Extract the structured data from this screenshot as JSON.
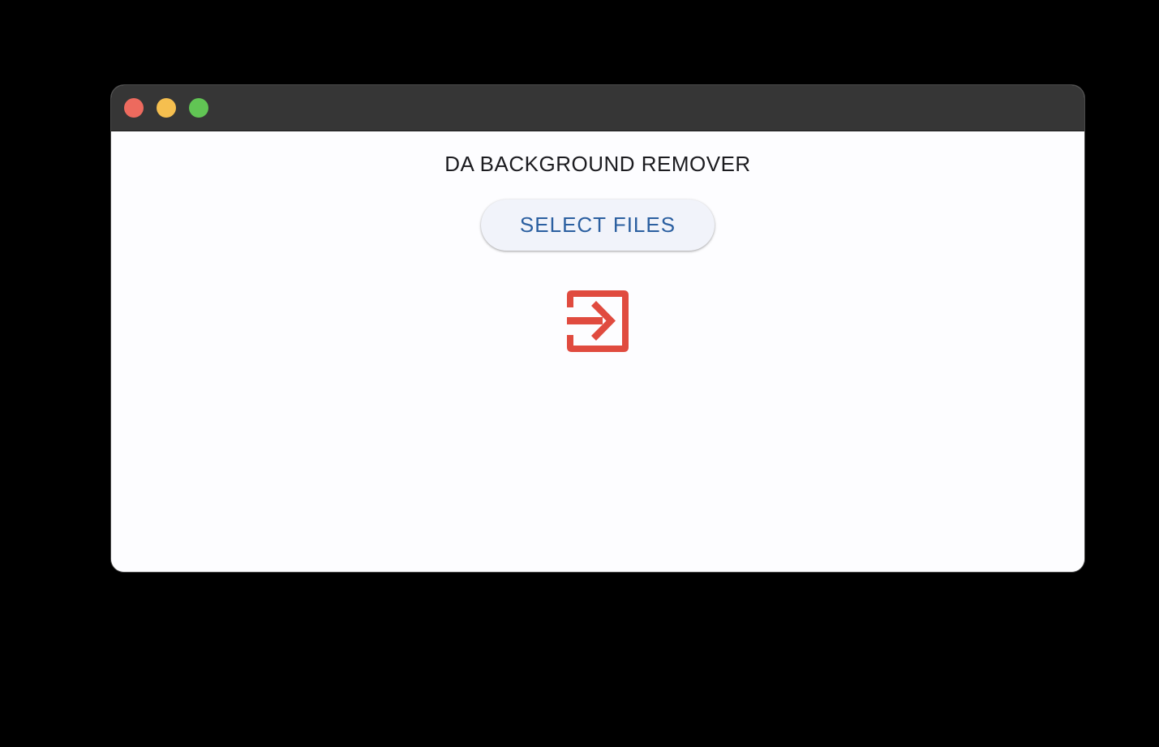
{
  "window": {
    "controls": {
      "close_icon": "close-traffic-light",
      "minimize_icon": "minimize-traffic-light",
      "zoom_icon": "zoom-traffic-light"
    },
    "colors": {
      "titlebar": "#363636",
      "close": "#ed6a5e",
      "minimize": "#f5bf4f",
      "zoom": "#61c554",
      "background": "#fdfdff"
    }
  },
  "main": {
    "title": "DA BACKGROUND REMOVER",
    "select_button_label": "SELECT FILES",
    "drop_icon": "input-arrow-icon",
    "colors": {
      "button_text": "#2b5fa0",
      "button_bg": "#f1f3fa",
      "icon": "#e04b3f"
    }
  }
}
